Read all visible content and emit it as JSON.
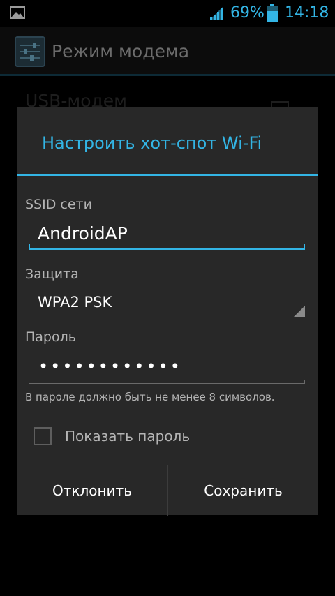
{
  "status_bar": {
    "battery_percent": "69%",
    "time": "14:18",
    "icons": [
      "image-notification-icon",
      "signal-strength-icon",
      "battery-icon"
    ]
  },
  "action_bar": {
    "title": "Режим модема",
    "icon": "settings-app-icon"
  },
  "background_list": {
    "row_title": "USB-модем"
  },
  "dialog": {
    "title": "Настроить хот-спот Wi-Fi",
    "ssid_label": "SSID сети",
    "ssid_value": "AndroidAP",
    "security_label": "Защита",
    "security_value": "WPA2 PSK",
    "password_label": "Пароль",
    "password_value": "••••••••••••",
    "password_hint": "В пароле должно быть не менее 8 символов.",
    "show_password_label": "Показать пароль",
    "show_password_checked": false,
    "buttons": {
      "cancel": "Отклонить",
      "save": "Сохранить"
    }
  },
  "colors": {
    "accent": "#33b5e5",
    "dialog_bg": "#282828",
    "text_secondary": "#b4b4b4"
  }
}
